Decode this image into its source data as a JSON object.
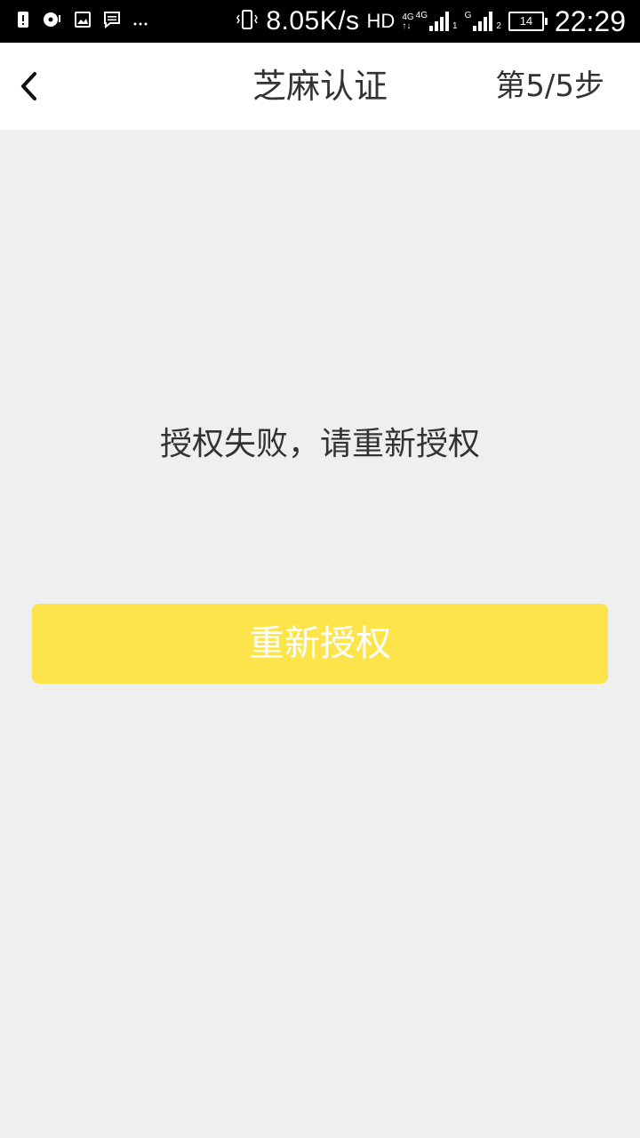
{
  "status_bar": {
    "net_speed": "8.05K/s",
    "hd": "HD",
    "net1": "4G",
    "net2": "4G",
    "sim1": "1",
    "sim2_label": "G",
    "sim2": "2",
    "battery": "14",
    "time": "22:29",
    "icons": [
      "alert-icon",
      "music-icon",
      "image-icon",
      "message-icon",
      "more-icon",
      "vibrate-icon",
      "signal-icon",
      "battery-icon"
    ]
  },
  "header": {
    "title": "芝麻认证",
    "step": "第5/5步"
  },
  "main": {
    "message": "授权失败，请重新授权",
    "retry_button": "重新授权"
  },
  "colors": {
    "accent": "#fde44b",
    "background": "#efefef"
  }
}
